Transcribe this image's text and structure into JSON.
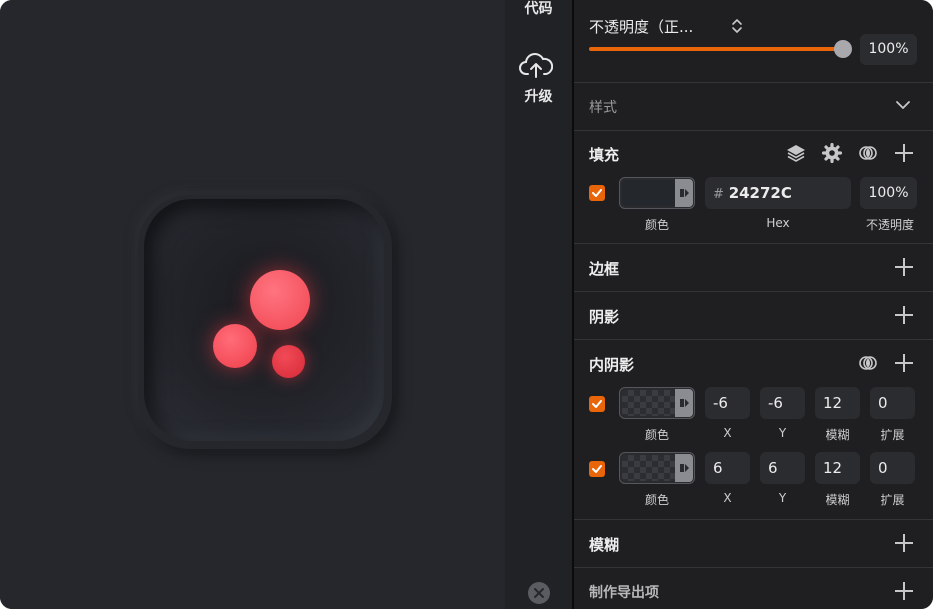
{
  "colors": {
    "accent": "#e8650a",
    "canvas_bg": "#25272c",
    "panel_bg": "#1f1f21",
    "dot_red": "#f04651"
  },
  "sidebar": {
    "code_label": "代码",
    "upgrade_label": "升级",
    "upgrade_icon": "cloud-upload-icon",
    "close_icon": "close-circle-icon"
  },
  "opacity_section": {
    "mode_label": "不透明度（正...",
    "value": "100%",
    "slider_fraction": 1.0
  },
  "style_section": {
    "title": "样式"
  },
  "fill_section": {
    "title": "填充",
    "icons": [
      "layers-icon",
      "gear-icon",
      "blend-icon",
      "plus-icon"
    ],
    "checked": true,
    "color_caption": "颜色",
    "hex_prefix": "#",
    "hex_value": "24272C",
    "hex_caption": "Hex",
    "opacity_value": "100%",
    "opacity_caption": "不透明度"
  },
  "border_section": {
    "title": "边框"
  },
  "shadow_section": {
    "title": "阴影"
  },
  "inner_shadow_section": {
    "title": "内阴影",
    "captions": {
      "color": "颜色",
      "x": "X",
      "y": "Y",
      "blur": "模糊",
      "spread": "扩展"
    },
    "rows": [
      {
        "checked": true,
        "x": "-6",
        "y": "-6",
        "blur": "12",
        "spread": "0"
      },
      {
        "checked": true,
        "x": "6",
        "y": "6",
        "blur": "12",
        "spread": "0"
      }
    ]
  },
  "blur_section": {
    "title": "模糊"
  },
  "export_section": {
    "title": "制作导出项"
  }
}
